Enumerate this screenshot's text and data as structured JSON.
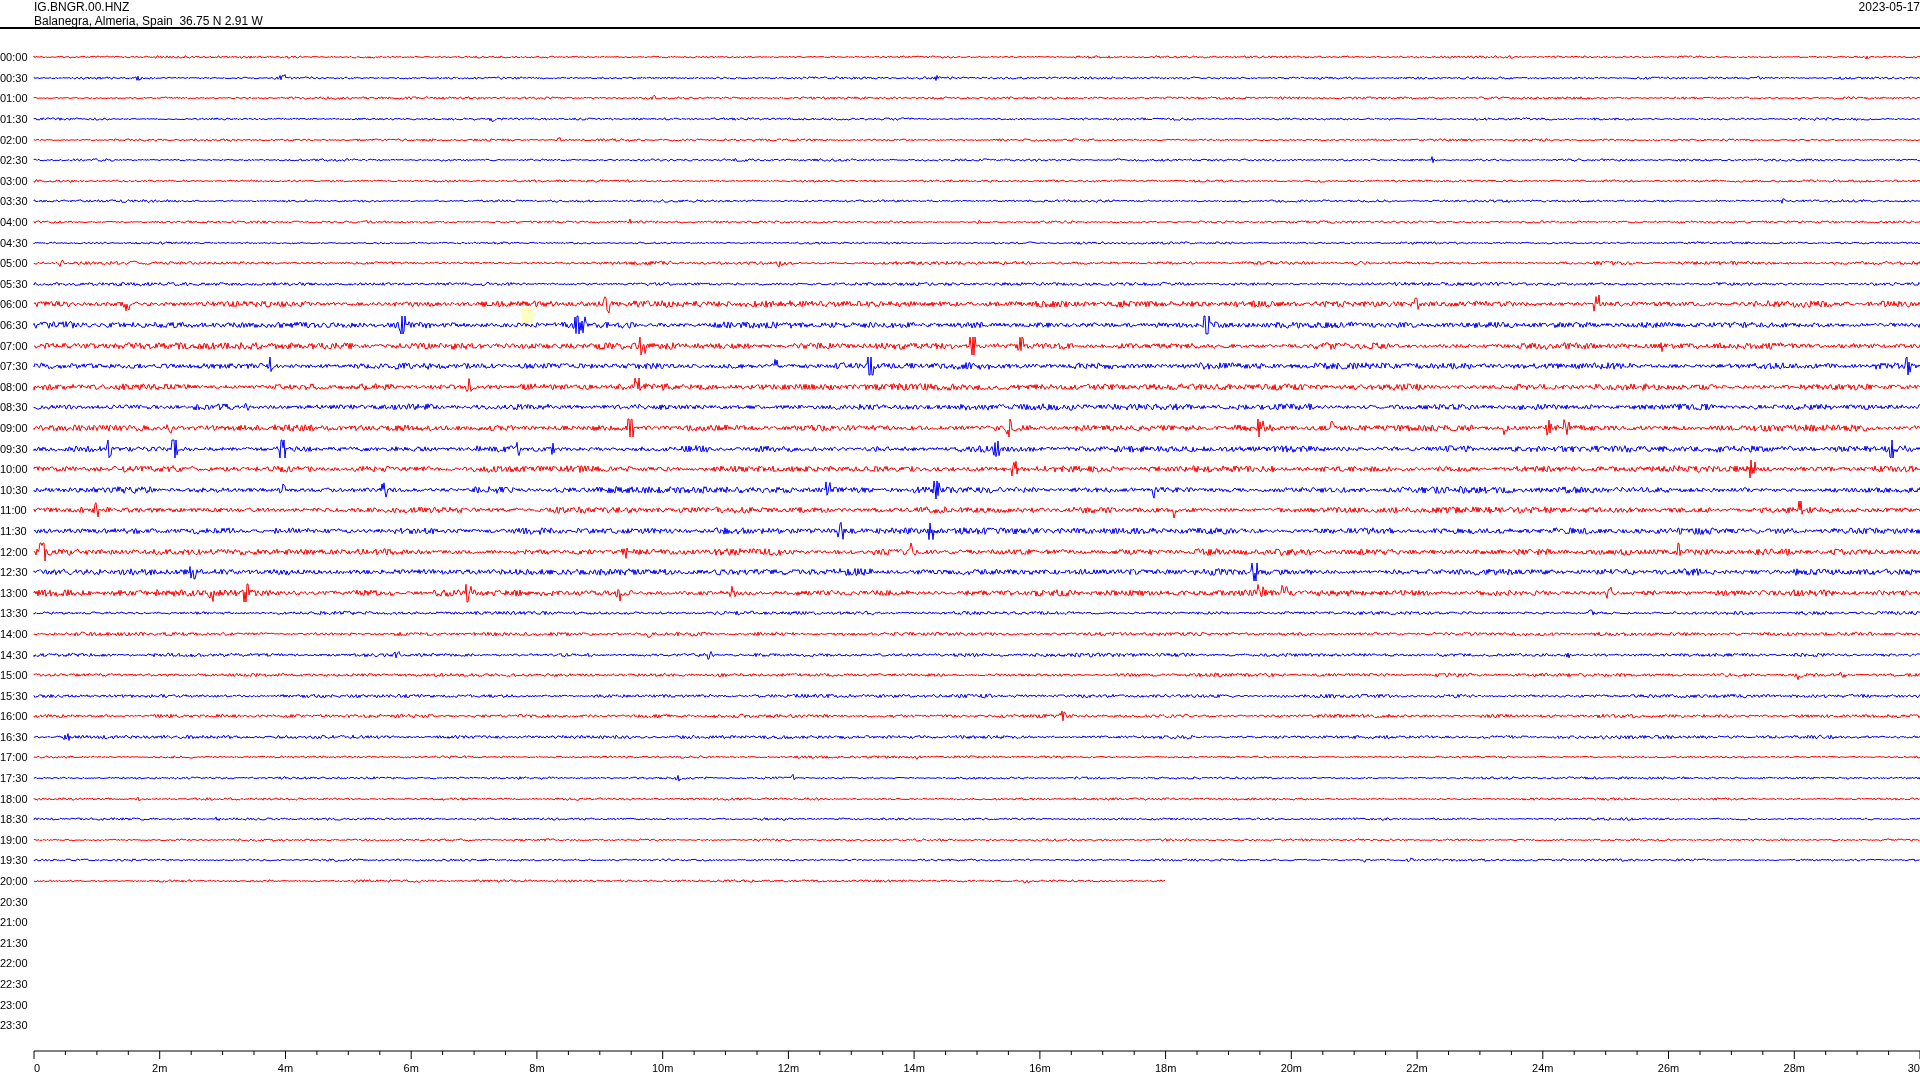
{
  "header": {
    "station": "IG.BNGR.00.HNZ",
    "location": "Balanegra, Almeria, Spain  36.75 N 2.91 W",
    "date": "2023-05-17"
  },
  "rows": [
    {
      "time": "00:00",
      "color": "#ff0000",
      "level": 1
    },
    {
      "time": "00:30",
      "color": "#0000ff",
      "level": 1
    },
    {
      "time": "01:00",
      "color": "#ff0000",
      "level": 1
    },
    {
      "time": "01:30",
      "color": "#0000ff",
      "level": 1
    },
    {
      "time": "02:00",
      "color": "#ff0000",
      "level": 1
    },
    {
      "time": "02:30",
      "color": "#0000ff",
      "level": 1
    },
    {
      "time": "03:00",
      "color": "#ff0000",
      "level": 1
    },
    {
      "time": "03:30",
      "color": "#0000ff",
      "level": 1
    },
    {
      "time": "04:00",
      "color": "#ff0000",
      "level": 1
    },
    {
      "time": "04:30",
      "color": "#0000ff",
      "level": 1
    },
    {
      "time": "05:00",
      "color": "#ff0000",
      "level": 1
    },
    {
      "time": "05:30",
      "color": "#0000ff",
      "level": 1
    },
    {
      "time": "06:00",
      "color": "#ff0000",
      "level": 1
    },
    {
      "time": "06:30",
      "color": "#0000ff",
      "level": 1
    },
    {
      "time": "07:00",
      "color": "#ff0000",
      "level": 1
    },
    {
      "time": "07:30",
      "color": "#0000ff",
      "level": 1
    },
    {
      "time": "08:00",
      "color": "#ff0000",
      "level": 1
    },
    {
      "time": "08:30",
      "color": "#0000ff",
      "level": 1
    },
    {
      "time": "09:00",
      "color": "#ff0000",
      "level": 1
    },
    {
      "time": "09:30",
      "color": "#0000ff",
      "level": 1
    },
    {
      "time": "10:00",
      "color": "#ff0000",
      "level": 1
    },
    {
      "time": "10:30",
      "color": "#0000ff",
      "level": 1
    },
    {
      "time": "11:00",
      "color": "#ff0000",
      "level": 1
    },
    {
      "time": "11:30",
      "color": "#0000ff",
      "level": 1
    },
    {
      "time": "12:00",
      "color": "#ff0000",
      "level": 1
    },
    {
      "time": "12:30",
      "color": "#0000ff",
      "level": 1
    },
    {
      "time": "13:00",
      "color": "#ff0000",
      "level": 1
    },
    {
      "time": "13:30",
      "color": "#0000ff",
      "level": 1
    },
    {
      "time": "14:00",
      "color": "#ff0000",
      "level": 1
    },
    {
      "time": "14:30",
      "color": "#0000ff",
      "level": 1
    },
    {
      "time": "15:00",
      "color": "#ff0000",
      "level": 1
    },
    {
      "time": "15:30",
      "color": "#0000ff",
      "level": 1
    },
    {
      "time": "16:00",
      "color": "#ff0000",
      "level": 1
    },
    {
      "time": "16:30",
      "color": "#0000ff",
      "level": 1
    },
    {
      "time": "17:00",
      "color": "#ff0000",
      "level": 1
    },
    {
      "time": "17:30",
      "color": "#0000ff",
      "level": 1
    },
    {
      "time": "18:00",
      "color": "#ff0000",
      "level": 1
    },
    {
      "time": "18:30",
      "color": "#0000ff",
      "level": 1
    },
    {
      "time": "19:00",
      "color": "#ff0000",
      "level": 1
    },
    {
      "time": "19:30",
      "color": "#0000ff",
      "level": 1
    },
    {
      "time": "20:00",
      "color": "#ff0000",
      "level": 0.6
    },
    {
      "time": "20:30"
    },
    {
      "time": "21:00"
    },
    {
      "time": "21:30"
    },
    {
      "time": "22:00"
    },
    {
      "time": "22:30"
    },
    {
      "time": "23:00"
    },
    {
      "time": "23:30"
    }
  ],
  "axis_labels": [
    "0",
    "2m",
    "4m",
    "6m",
    "8m",
    "10m",
    "12m",
    "14m",
    "16m",
    "18m",
    "20m",
    "22m",
    "24m",
    "26m",
    "28m",
    "30"
  ]
}
